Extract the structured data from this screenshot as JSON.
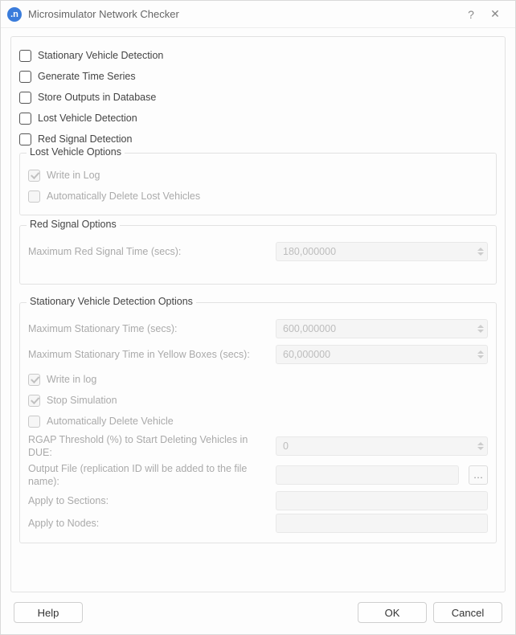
{
  "titlebar": {
    "app_icon_letter": ".n",
    "title": "Microsimulator Network Checker",
    "help_glyph": "?",
    "close_glyph": "✕"
  },
  "checkboxes": {
    "stationary_vehicle_detection": "Stationary Vehicle Detection",
    "generate_time_series": "Generate Time Series",
    "store_outputs_in_database": "Store Outputs in Database",
    "lost_vehicle_detection": "Lost Vehicle Detection",
    "red_signal_detection": "Red Signal Detection"
  },
  "lost_vehicle_options": {
    "legend": "Lost Vehicle Options",
    "write_in_log": "Write in Log",
    "auto_delete": "Automatically Delete Lost Vehicles"
  },
  "red_signal_options": {
    "legend": "Red Signal Options",
    "max_red_time_label": "Maximum Red Signal Time (secs):",
    "max_red_time_value": "180,000000"
  },
  "svd_options": {
    "legend": "Stationary Vehicle Detection Options",
    "max_stationary_time_label": "Maximum Stationary Time (secs):",
    "max_stationary_time_value": "600,000000",
    "max_stationary_yellow_label": "Maximum Stationary Time in Yellow Boxes (secs):",
    "max_stationary_yellow_value": "60,000000",
    "write_in_log": "Write in log",
    "stop_simulation": "Stop Simulation",
    "auto_delete_vehicle": "Automatically Delete Vehicle",
    "rgap_label": "RGAP Threshold (%) to Start Deleting Vehicles in DUE:",
    "rgap_value": "0",
    "output_file_label": "Output File (replication ID will be added to the file name):",
    "output_file_value": "",
    "apply_sections_label": "Apply to Sections:",
    "apply_sections_value": "",
    "apply_nodes_label": "Apply to Nodes:",
    "apply_nodes_value": "",
    "browse_glyph": "…"
  },
  "footer": {
    "help": "Help",
    "ok": "OK",
    "cancel": "Cancel"
  }
}
